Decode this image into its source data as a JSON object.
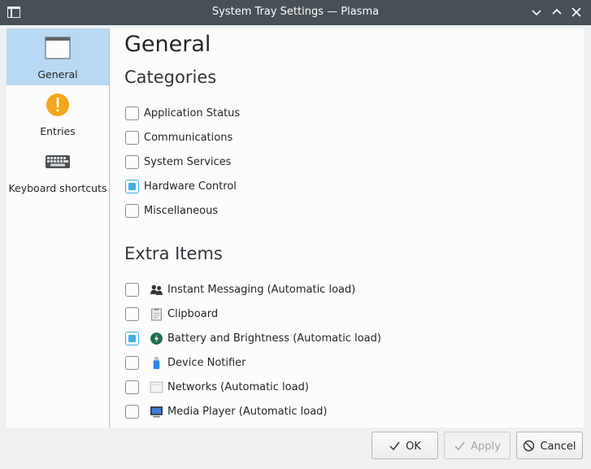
{
  "window": {
    "title": "System Tray Settings — Plasma"
  },
  "sidebar": {
    "items": [
      {
        "label": "General",
        "icon": "window-icon",
        "selected": true
      },
      {
        "label": "Entries",
        "icon": "warning-icon",
        "selected": false
      },
      {
        "label": "Keyboard shortcuts",
        "icon": "keyboard-icon",
        "selected": false
      }
    ]
  },
  "content": {
    "page_title": "General",
    "categories": {
      "title": "Categories",
      "items": [
        {
          "label": "Application Status",
          "checked": false
        },
        {
          "label": "Communications",
          "checked": false
        },
        {
          "label": "System Services",
          "checked": false
        },
        {
          "label": "Hardware Control",
          "checked": true
        },
        {
          "label": "Miscellaneous",
          "checked": false
        }
      ]
    },
    "extra_items": {
      "title": "Extra Items",
      "items": [
        {
          "label": "Instant Messaging (Automatic load)",
          "icon": "contacts-icon",
          "checked": false
        },
        {
          "label": "Clipboard",
          "icon": "clipboard-icon",
          "checked": false
        },
        {
          "label": "Battery and Brightness (Automatic load)",
          "icon": "battery-icon",
          "checked": true
        },
        {
          "label": "Device Notifier",
          "icon": "usb-device-icon",
          "checked": false
        },
        {
          "label": "Networks (Automatic load)",
          "icon": "network-icon",
          "checked": false
        },
        {
          "label": "Media Player (Automatic load)",
          "icon": "media-player-icon",
          "checked": false
        }
      ]
    }
  },
  "buttons": {
    "ok": "OK",
    "apply": "Apply",
    "cancel": "Cancel"
  },
  "colors": {
    "accent": "#3daee9",
    "selection": "#b8d9f3",
    "titlebar": "#475057"
  }
}
